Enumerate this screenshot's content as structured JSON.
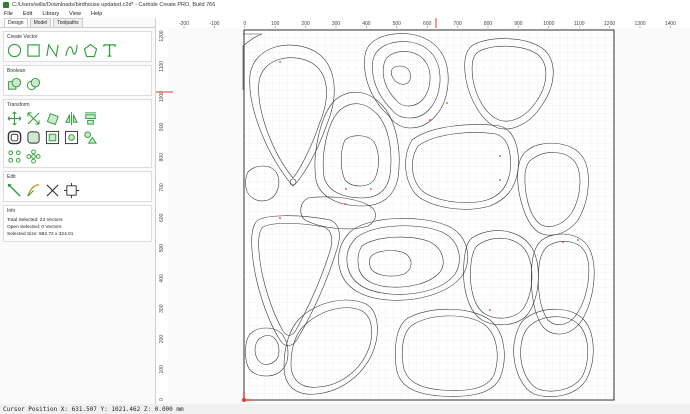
{
  "window": {
    "title": "C:/Users/wills/Downloads/birdhouse updated.c2d* - Carbide Create PRO, Build 766"
  },
  "menu": [
    "File",
    "Edit",
    "Library",
    "View",
    "Help"
  ],
  "tabs": [
    "Design",
    "Model",
    "Toolpaths"
  ],
  "sections": {
    "create_vector": "Create Vector",
    "boolean": "Boolean",
    "transform": "Transform",
    "edit": "Edit",
    "info": "Info"
  },
  "info": {
    "total_selected": "Total Selected:  23 Vectors",
    "open_selected": "Open Selected:  0 Vectors",
    "selected_size": "Selected Size:   982.72 x 324.01"
  },
  "ruler_x_labels": [
    "-200",
    "-100",
    "0",
    "100",
    "200",
    "300",
    "400",
    "500",
    "600",
    "700",
    "800",
    "900",
    "1000",
    "1100",
    "1200",
    "1300",
    "1400"
  ],
  "ruler_y_labels": [
    "1200",
    "1100",
    "1000",
    "900",
    "800",
    "700",
    "600",
    "500",
    "400",
    "300",
    "200",
    "100",
    "0"
  ],
  "status": {
    "cursor": "Cursor Position X: 631.507 Y: 1021.462 Z: 0.000 mm"
  },
  "colors": {
    "accent": "#2e9d3a",
    "origin": "#e53935",
    "grid_minor": "#e6e6e6",
    "grid_major": "#cfcfcf"
  }
}
